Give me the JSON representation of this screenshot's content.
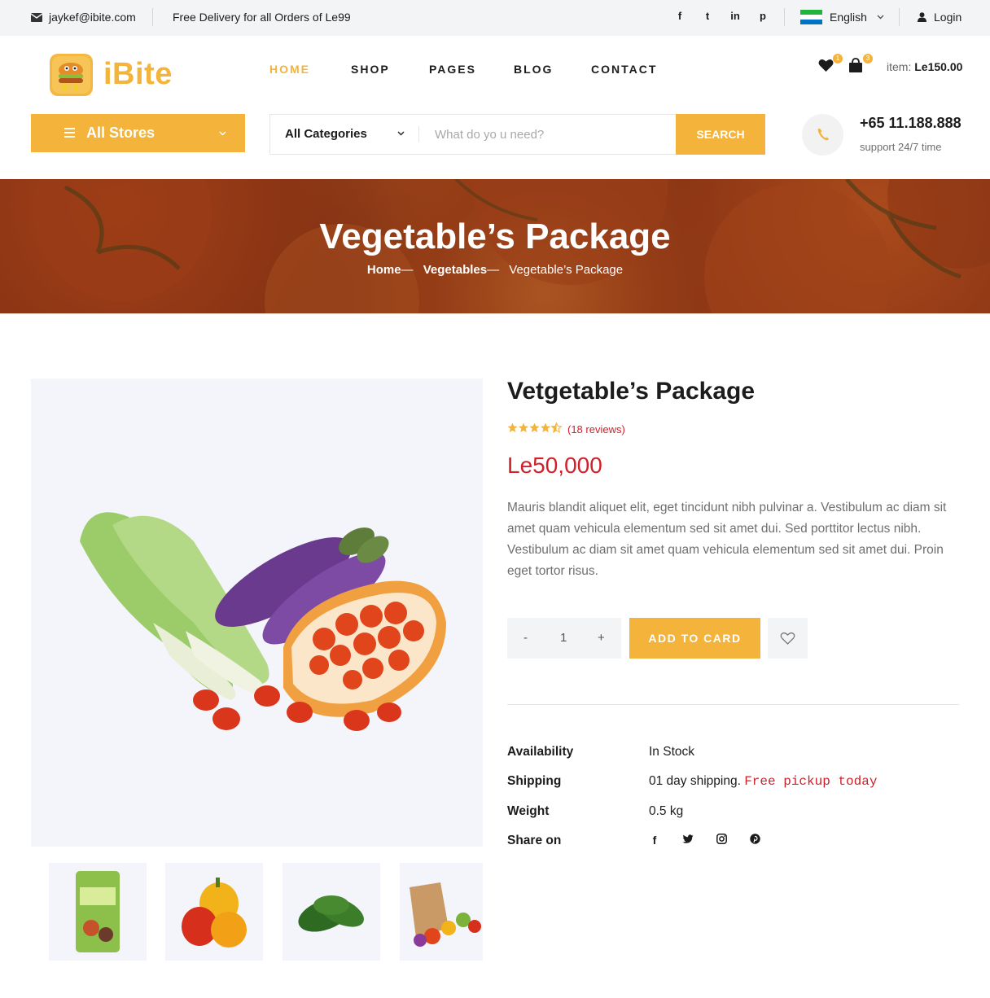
{
  "topbar": {
    "email": "jaykef@ibite.com",
    "delivery": "Free Delivery for all Orders of Le99",
    "social": [
      "f",
      "t",
      "in",
      "p"
    ],
    "language": "English",
    "login": "Login"
  },
  "header": {
    "logo": "iBite",
    "nav": [
      "HOME",
      "SHOP",
      "PAGES",
      "BLOG",
      "CONTACT"
    ],
    "wishlist_count": "1",
    "cart_count": "3",
    "cart_label": "item:",
    "cart_total": "Le150.00"
  },
  "search": {
    "stores_label": "All Stores",
    "category": "All Categories",
    "placeholder": "What do yo u need?",
    "button": "SEARCH",
    "phone": "+65 11.188.888",
    "support": "support 24/7 time"
  },
  "banner": {
    "title": "Vegetable’s Package",
    "crumb_home": "Home",
    "crumb_category": "Vegetables",
    "crumb_current": "Vegetable’s Package",
    "crumb_sep": "—"
  },
  "product": {
    "title": "Vetgetable’s Package",
    "rating": 4.5,
    "reviews": "(18 reviews)",
    "price": "Le50,000",
    "description": "Mauris blandit aliquet elit, eget tincidunt nibh pulvinar a. Vestibulum ac diam sit amet quam vehicula elementum sed sit amet dui. Sed porttitor lectus nibh. Vestibulum ac diam sit amet quam vehicula elementum sed sit amet dui. Proin eget tortor risus.",
    "qty_minus": "-",
    "qty_value": "1",
    "qty_plus": "+",
    "add_button": "ADD TO CARD",
    "specs": {
      "availability_label": "Availability",
      "availability_value": "In Stock",
      "shipping_label": "Shipping",
      "shipping_value": "01 day shipping.",
      "shipping_pickup": "Free pickup today",
      "weight_label": "Weight",
      "weight_value": "0.5 kg",
      "share_label": "Share on"
    }
  },
  "colors": {
    "accent": "#f4b33a",
    "price": "#d0202a"
  }
}
